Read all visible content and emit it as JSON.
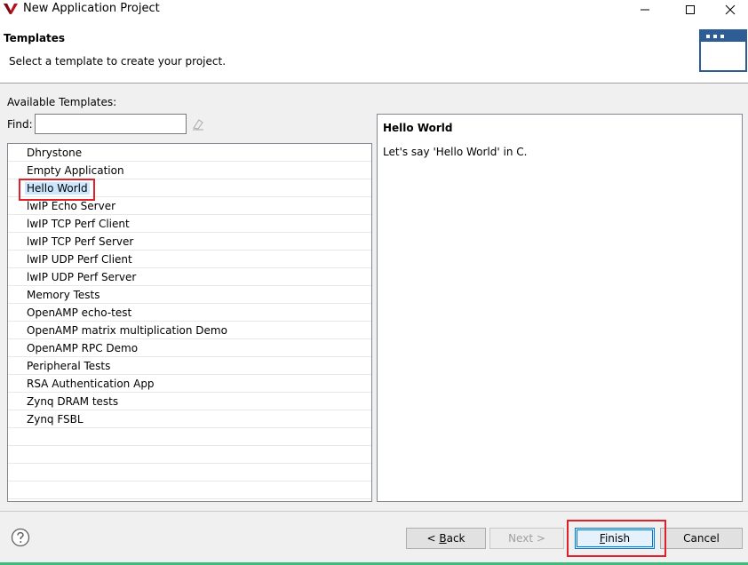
{
  "window": {
    "title": "New Application Project",
    "accent_color": "#2e5c95",
    "highlight_color": "#e0202a"
  },
  "header": {
    "title": "Templates",
    "description": "Select a template to create your project."
  },
  "templates": {
    "available_label": "Available Templates:",
    "find_label": "Find:",
    "find_value": "",
    "items": [
      {
        "label": "Dhrystone"
      },
      {
        "label": "Empty Application"
      },
      {
        "label": "Hello World",
        "selected": true
      },
      {
        "label": "lwIP Echo Server"
      },
      {
        "label": "lwIP TCP Perf Client"
      },
      {
        "label": "lwIP TCP Perf Server"
      },
      {
        "label": "lwIP UDP Perf Client"
      },
      {
        "label": "lwIP UDP Perf Server"
      },
      {
        "label": "Memory Tests"
      },
      {
        "label": "OpenAMP echo-test"
      },
      {
        "label": "OpenAMP matrix multiplication Demo"
      },
      {
        "label": "OpenAMP RPC Demo"
      },
      {
        "label": "Peripheral Tests"
      },
      {
        "label": "RSA Authentication App"
      },
      {
        "label": "Zynq DRAM tests"
      },
      {
        "label": "Zynq FSBL"
      }
    ]
  },
  "description_panel": {
    "title": "Hello World",
    "text": "Let's say 'Hello World' in C."
  },
  "footer": {
    "back_prefix": "< ",
    "back_mnemonic": "B",
    "back_rest": "ack",
    "next_label": "Next >",
    "finish_mnemonic": "F",
    "finish_rest": "inish",
    "cancel_label": "Cancel"
  }
}
